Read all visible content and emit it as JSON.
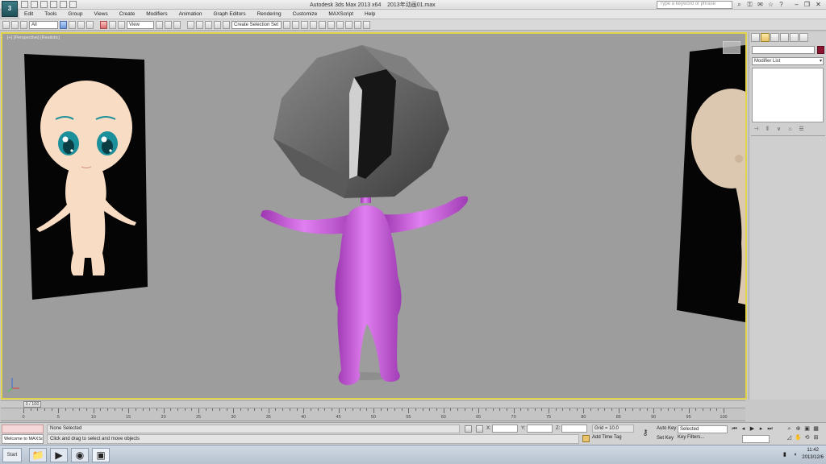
{
  "app": {
    "title": "Autodesk 3ds Max 2013 x64",
    "file": "2013年动画01.max",
    "logo": "3",
    "help_search_placeholder": "Type a keyword or phrase"
  },
  "menu": [
    "Edit",
    "Tools",
    "Group",
    "Views",
    "Create",
    "Modifiers",
    "Animation",
    "Graph Editors",
    "Rendering",
    "Customize",
    "MAXScript",
    "Help"
  ],
  "toolbar": {
    "undo_count": "↶",
    "selection_filter": "All",
    "reference_coord": "View",
    "named_selection": "Create Selection Set"
  },
  "viewport": {
    "label": "[+] [Perspective] [Realistic]",
    "character_color": "#c85ad8",
    "head_color": "#6e6e6e",
    "reference_panel_color": "#050505",
    "skin_color": "#f9dcc4",
    "eye_color": "#1b8f9a"
  },
  "command_panel": {
    "modifier_list": "Modifier List",
    "object_color": "#8a1530"
  },
  "timeline": {
    "current_frame": "0 / 100",
    "ticks": [
      "0",
      "5",
      "10",
      "15",
      "20",
      "25",
      "30",
      "35",
      "40",
      "45",
      "50",
      "55",
      "60",
      "65",
      "70",
      "75",
      "80",
      "85",
      "90",
      "95",
      "100"
    ]
  },
  "status": {
    "maxscript": "Welcome to MAXScript",
    "selection": "None Selected",
    "prompt": "Click and drag to select and move objects",
    "x_label": "X:",
    "y_label": "Y:",
    "z_label": "Z:",
    "grid": "Grid = 10.0",
    "add_time_tag": "Add Time Tag",
    "auto_key": "Auto Key",
    "set_key": "Set Key",
    "selected": "Selected",
    "key_filters": "Key Filters...",
    "clock_time": "11:42",
    "clock_date": "2013/12/6"
  },
  "taskbar": {
    "start": "Start"
  }
}
